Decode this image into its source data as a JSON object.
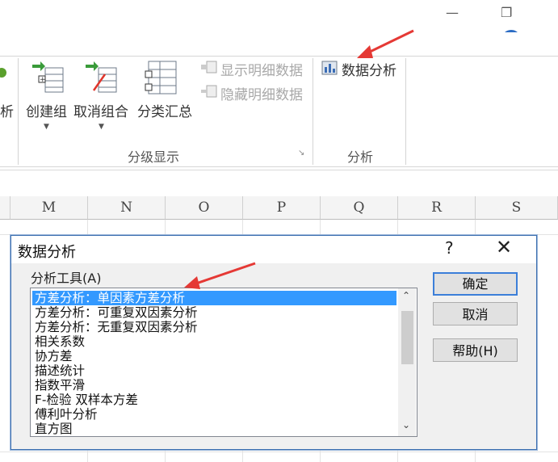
{
  "window": {
    "restore_glyph": "❐",
    "help_glyph": "?",
    "minimize_ribbon_glyph": "▭",
    "account_glyph": "⌂"
  },
  "ribbon": {
    "partial_label": "析",
    "buttons": {
      "group": "创建组",
      "ungroup": "取消组合",
      "subtotal": "分类汇总",
      "show_detail": "显示明细数据",
      "hide_detail": "隐藏明细数据",
      "data_analysis": "数据分析"
    },
    "groups": {
      "outline": "分级显示",
      "analysis": "分析"
    }
  },
  "columns": [
    "M",
    "N",
    "O",
    "P",
    "Q",
    "R",
    "S"
  ],
  "dialog": {
    "title": "数据分析",
    "help_btn": "?",
    "close_btn": "✕",
    "tools_label": "分析工具(A)",
    "tools": [
      "方差分析：单因素方差分析",
      "方差分析：可重复双因素分析",
      "方差分析：无重复双因素分析",
      "相关系数",
      "协方差",
      "描述统计",
      "指数平滑",
      "F-检验 双样本方差",
      "傅利叶分析",
      "直方图"
    ],
    "selected_index": 0,
    "ok": "确定",
    "cancel": "取消",
    "help": "帮助(H)"
  },
  "colors": {
    "selection": "#3399ff",
    "annotation_arrow": "#e53935",
    "dialog_border": "#3c6fb0"
  }
}
